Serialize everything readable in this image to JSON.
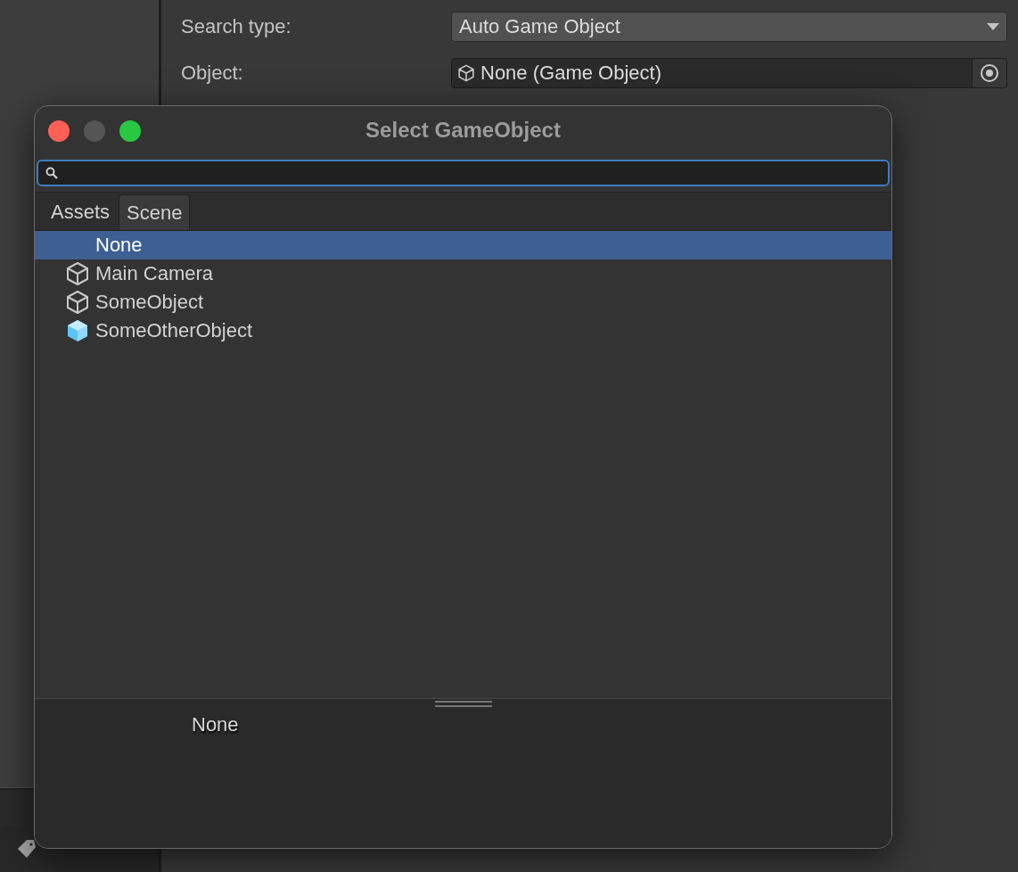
{
  "inspector": {
    "fields": [
      {
        "label": "Search type:",
        "kind": "dropdown",
        "value": "Auto Game Object"
      },
      {
        "label": "Object:",
        "kind": "object",
        "value": "None (Game Object)"
      }
    ]
  },
  "dialog": {
    "title": "Select GameObject",
    "tabs": [
      {
        "label": "Assets",
        "selected": false
      },
      {
        "label": "Scene",
        "selected": true
      }
    ],
    "items": [
      {
        "label": "None",
        "kind": "none",
        "selected": true
      },
      {
        "label": "Main Camera",
        "kind": "object",
        "selected": false
      },
      {
        "label": "SomeObject",
        "kind": "object",
        "selected": false
      },
      {
        "label": "SomeOtherObject",
        "kind": "prefab",
        "selected": false
      }
    ],
    "preview": {
      "label": "None"
    }
  }
}
